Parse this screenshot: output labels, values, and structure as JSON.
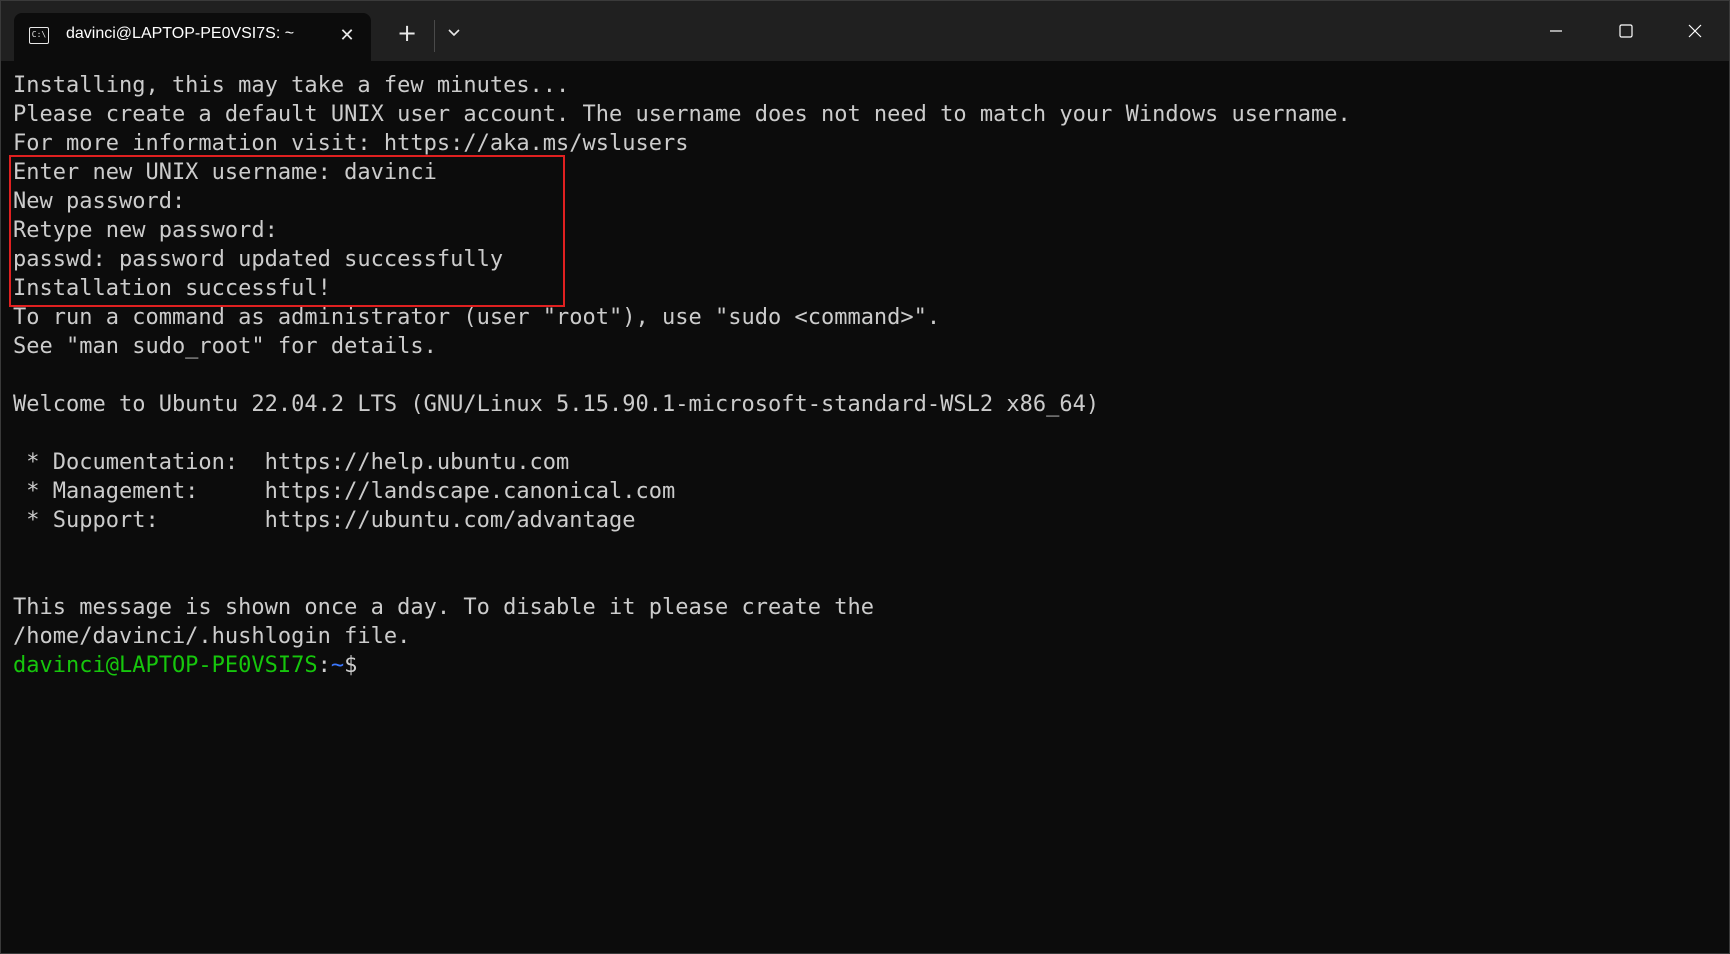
{
  "window": {
    "tab": {
      "icon": "terminal-cmd-icon",
      "icon_text": "C:\\",
      "title": "davinci@LAPTOP-PE0VSI7S: ~",
      "close_glyph": "✕"
    },
    "new_tab_glyph": "+",
    "dropdown_icon": "chevron-down-icon",
    "controls": {
      "minimize_icon": "minimize-icon",
      "maximize_icon": "maximize-icon",
      "close_icon": "close-icon"
    }
  },
  "terminal": {
    "lines": [
      "Installing, this may take a few minutes...",
      "Please create a default UNIX user account. The username does not need to match your Windows username.",
      "For more information visit: https://aka.ms/wslusers",
      "Enter new UNIX username: davinci",
      "New password:",
      "Retype new password:",
      "passwd: password updated successfully",
      "Installation successful!",
      "To run a command as administrator (user \"root\"), use \"sudo <command>\".",
      "See \"man sudo_root\" for details.",
      "",
      "Welcome to Ubuntu 22.04.2 LTS (GNU/Linux 5.15.90.1-microsoft-standard-WSL2 x86_64)",
      "",
      " * Documentation:  https://help.ubuntu.com",
      " * Management:     https://landscape.canonical.com",
      " * Support:        https://ubuntu.com/advantage",
      "",
      "",
      "This message is shown once a day. To disable it please create the",
      "/home/davinci/.hushlogin file."
    ],
    "prompt": {
      "user_host": "davinci@LAPTOP-PE0VSI7S",
      "separator": ":",
      "path": "~",
      "symbol": "$"
    }
  },
  "colors": {
    "background": "#0c0c0c",
    "titlebar": "#202020",
    "text": "#cccccc",
    "prompt_user": "#16c60c",
    "prompt_path": "#3b78ff",
    "highlight_border": "#e02020"
  }
}
